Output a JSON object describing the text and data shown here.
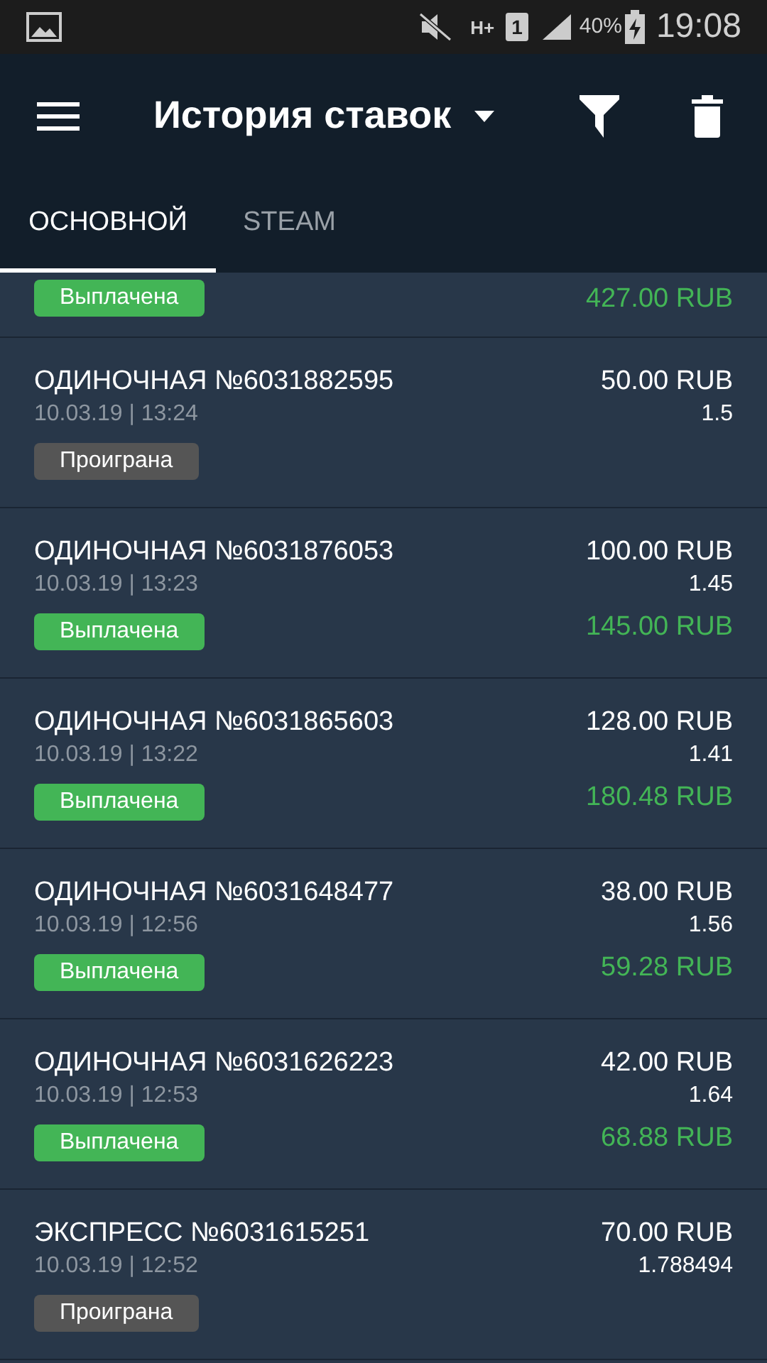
{
  "status_bar": {
    "network": "H+",
    "sim": "1",
    "battery": "40%",
    "time": "19:08"
  },
  "app_bar": {
    "title": "История ставок"
  },
  "tabs": [
    {
      "label": "ОСНОВНОЙ",
      "selected": true
    },
    {
      "label": "STEAM",
      "selected": false
    }
  ],
  "partial_bet": {
    "status": {
      "kind": "won",
      "label": "Выплачена"
    },
    "payout": "427.00 RUB"
  },
  "bets": [
    {
      "title": "ОДИНОЧНАЯ №6031882595",
      "date": "10.03.19 | 13:24",
      "stake": "50.00 RUB",
      "odds": "1.5",
      "status": {
        "kind": "lost",
        "label": "Проиграна"
      }
    },
    {
      "title": "ОДИНОЧНАЯ №6031876053",
      "date": "10.03.19 | 13:23",
      "stake": "100.00 RUB",
      "odds": "1.45",
      "status": {
        "kind": "won",
        "label": "Выплачена"
      },
      "payout": "145.00 RUB"
    },
    {
      "title": "ОДИНОЧНАЯ №6031865603",
      "date": "10.03.19 | 13:22",
      "stake": "128.00 RUB",
      "odds": "1.41",
      "status": {
        "kind": "won",
        "label": "Выплачена"
      },
      "payout": "180.48 RUB"
    },
    {
      "title": "ОДИНОЧНАЯ №6031648477",
      "date": "10.03.19 | 12:56",
      "stake": "38.00 RUB",
      "odds": "1.56",
      "status": {
        "kind": "won",
        "label": "Выплачена"
      },
      "payout": "59.28 RUB"
    },
    {
      "title": "ОДИНОЧНАЯ №6031626223",
      "date": "10.03.19 | 12:53",
      "stake": "42.00 RUB",
      "odds": "1.64",
      "status": {
        "kind": "won",
        "label": "Выплачена"
      },
      "payout": "68.88 RUB"
    },
    {
      "title": "ЭКСПРЕСС №6031615251",
      "date": "10.03.19 | 12:52",
      "stake": "70.00 RUB",
      "odds": "1.788494",
      "status": {
        "kind": "lost",
        "label": "Проиграна"
      }
    }
  ]
}
